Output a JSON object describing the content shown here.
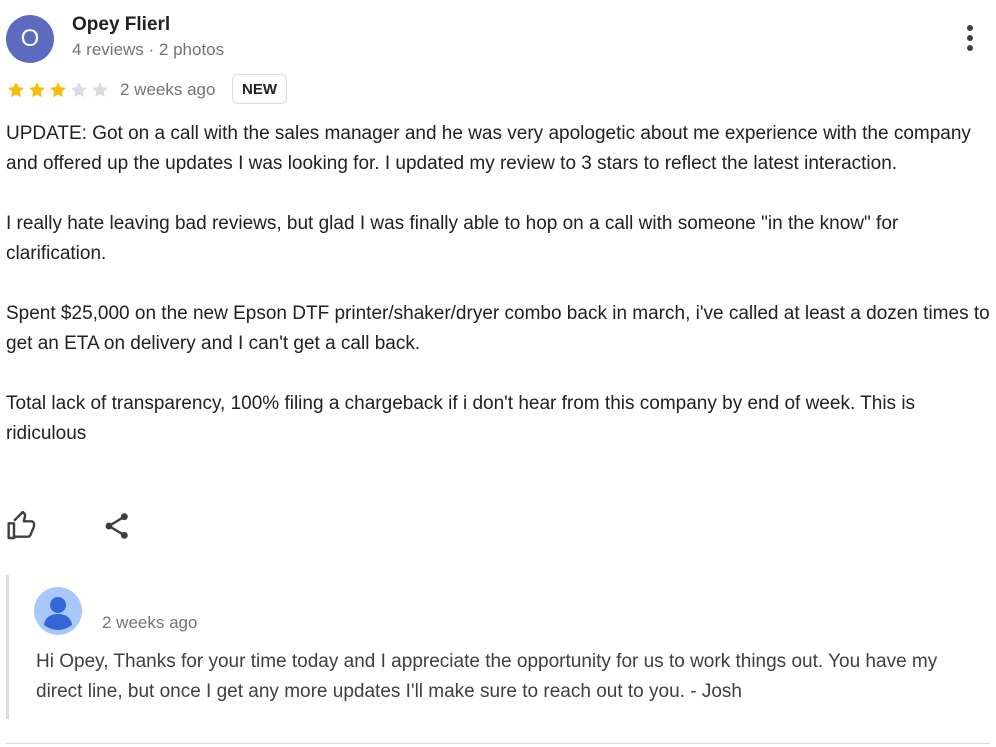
{
  "reviewer": {
    "initial": "O",
    "avatar_color": "#5c6bc0",
    "name": "Opey Flierl",
    "meta": "4 reviews · 2 photos"
  },
  "review": {
    "rating": 3,
    "max_rating": 5,
    "time": "2 weeks ago",
    "badge": "NEW",
    "paragraphs": [
      "UPDATE: Got on a call with the sales manager and he was very apologetic about me experience with the company and offered up the updates I was looking for. I updated my review to 3 stars to reflect the latest interaction.",
      "I really hate leaving bad reviews, but glad I was finally able to hop on a call with someone \"in the know\" for clarification.",
      "Spent $25,000 on the new Epson DTF printer/shaker/dryer combo back in march, i've called at least a dozen times to get an ETA on delivery and I can't get a call back.",
      "Total lack of transparency, 100% filing a chargeback if i don't hear from this company by end of week. This is ridiculous"
    ]
  },
  "actions": {
    "like_icon": "thumbs-up-icon",
    "share_icon": "share-icon",
    "more_icon": "more-vert-icon"
  },
  "owner_reply": {
    "time": "2 weeks ago",
    "text": "Hi Opey, Thanks for your time today and I appreciate the opportunity for us to work things out. You have my direct line, but once I get any more updates I'll make sure to reach out to you. - Josh"
  },
  "colors": {
    "star_filled": "#fbbc04",
    "star_empty": "#dadce0",
    "secondary_text": "#70757a"
  }
}
